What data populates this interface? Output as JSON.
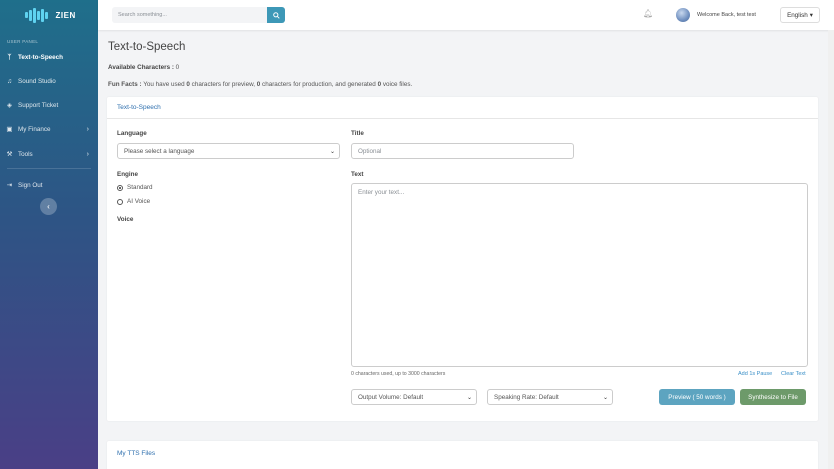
{
  "brand": {
    "name": "ZIEN"
  },
  "sidebar": {
    "panel_label": "USER PANEL",
    "items": [
      {
        "label": "Text-to-Speech",
        "icon": "tts-icon"
      },
      {
        "label": "Sound Studio",
        "icon": "music-icon"
      },
      {
        "label": "Support Ticket",
        "icon": "tag-icon"
      },
      {
        "label": "My Finance",
        "icon": "wallet-icon"
      },
      {
        "label": "Tools",
        "icon": "wrench-icon"
      },
      {
        "label": "Sign Out",
        "icon": "signout-icon"
      }
    ]
  },
  "topbar": {
    "search_placeholder": "Search something...",
    "welcome": "Welcome Back, test test",
    "language": "English"
  },
  "page": {
    "title": "Text-to-Speech",
    "available_label": "Available Characters :",
    "available_value": "0",
    "facts_label": "Fun Facts :",
    "facts_t1": " You have used ",
    "facts_n1": "0",
    "facts_t2": " characters for preview, ",
    "facts_n2": "0",
    "facts_t3": " characters for production, and generated ",
    "facts_n3": "0",
    "facts_t4": " voice files."
  },
  "form": {
    "card_title": "Text-to-Speech",
    "language_label": "Language",
    "language_value": "Please select a language",
    "title_label": "Title",
    "title_placeholder": "Optional",
    "engine_label": "Engine",
    "engine_options": [
      "Standard",
      "AI Voice"
    ],
    "voice_label": "Voice",
    "text_label": "Text",
    "text_placeholder": "Enter your text...",
    "char_count": "0 characters used, up to 3000 characters",
    "add_pause": "Add 1s Pause",
    "clear_text": "Clear Text",
    "volume_value": "Output Volume: Default",
    "rate_value": "Speaking Rate: Default",
    "preview_button": "Preview ( 50 words )",
    "synthesize_button": "Synthesize to File"
  },
  "files": {
    "card_title": "My TTS Files"
  },
  "colors": {
    "accent": "#3d98b7",
    "link": "#2e6fae",
    "success": "#6d9a6a"
  }
}
